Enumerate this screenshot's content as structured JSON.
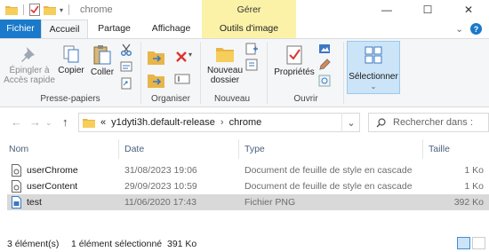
{
  "window": {
    "title": "chrome",
    "context_group": "Gérer",
    "controls": [
      "minimize",
      "maximize",
      "close"
    ]
  },
  "tabs": {
    "fichier": "Fichier",
    "accueil": "Accueil",
    "partage": "Partage",
    "affichage": "Affichage",
    "outils": "Outils d'image"
  },
  "ribbon": {
    "presse_papiers": {
      "label": "Presse-papiers",
      "epingler": "Épingler à\nAccès rapide",
      "copier": "Copier",
      "coller": "Coller"
    },
    "organiser": {
      "label": "Organiser"
    },
    "nouveau": {
      "label": "Nouveau",
      "nouveau_dossier": "Nouveau\ndossier"
    },
    "ouvrir": {
      "label": "Ouvrir",
      "proprietes": "Propriétés"
    },
    "selectionner": {
      "label": "Sélectionner"
    }
  },
  "address": {
    "overflow": "«",
    "crumbs": [
      "y1dyti3h.default-release",
      "chrome"
    ],
    "search_placeholder": "Rechercher dans :"
  },
  "columns": {
    "name": "Nom",
    "date": "Date",
    "type": "Type",
    "size": "Taille"
  },
  "files": [
    {
      "name": "userChrome",
      "date": "31/08/2023 19:06",
      "type": "Document de feuille de style en cascade",
      "size": "1 Ko",
      "icon": "css-file-icon",
      "selected": false
    },
    {
      "name": "userContent",
      "date": "29/09/2023 10:59",
      "type": "Document de feuille de style en cascade",
      "size": "1 Ko",
      "icon": "css-file-icon",
      "selected": false
    },
    {
      "name": "test",
      "date": "11/06/2020 17:43",
      "type": "Fichier PNG",
      "size": "392 Ko",
      "icon": "png-file-icon",
      "selected": true
    }
  ],
  "status": {
    "count": "3 élément(s)",
    "selection": "1 élément sélectionné  391 Ko"
  },
  "colors": {
    "accent": "#1979ca",
    "context_tab": "#fbf2a8",
    "selected_row": "#d9d9d9",
    "ribbon_bg": "#f5f6f7"
  }
}
